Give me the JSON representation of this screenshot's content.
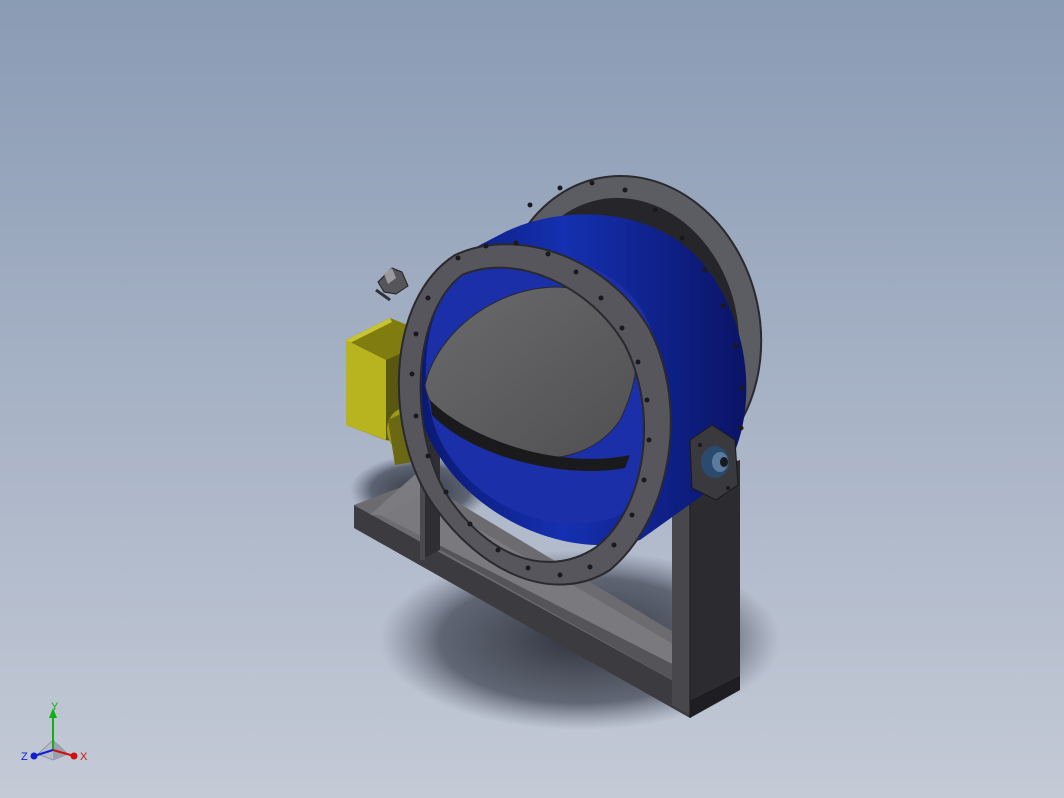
{
  "viewport": {
    "background_top": "#8a9bb4",
    "background_bottom": "#c4cad6"
  },
  "model": {
    "parts": [
      {
        "name": "duct-shell",
        "color": "#0d1f8c"
      },
      {
        "name": "front-flange",
        "color": "#56565c"
      },
      {
        "name": "rear-flange",
        "color": "#5c5c63"
      },
      {
        "name": "damper-disc",
        "color": "#5a5a5c"
      },
      {
        "name": "actuator-box",
        "color": "#b8b420"
      },
      {
        "name": "support-frame",
        "color": "#4a4a4e"
      },
      {
        "name": "bearing-housing",
        "color": "#2a4a6e"
      }
    ]
  },
  "triad": {
    "x_label": "X",
    "y_label": "Y",
    "z_label": "Z",
    "x_color": "#d01010",
    "y_color": "#10b010",
    "z_color": "#1020d0"
  }
}
